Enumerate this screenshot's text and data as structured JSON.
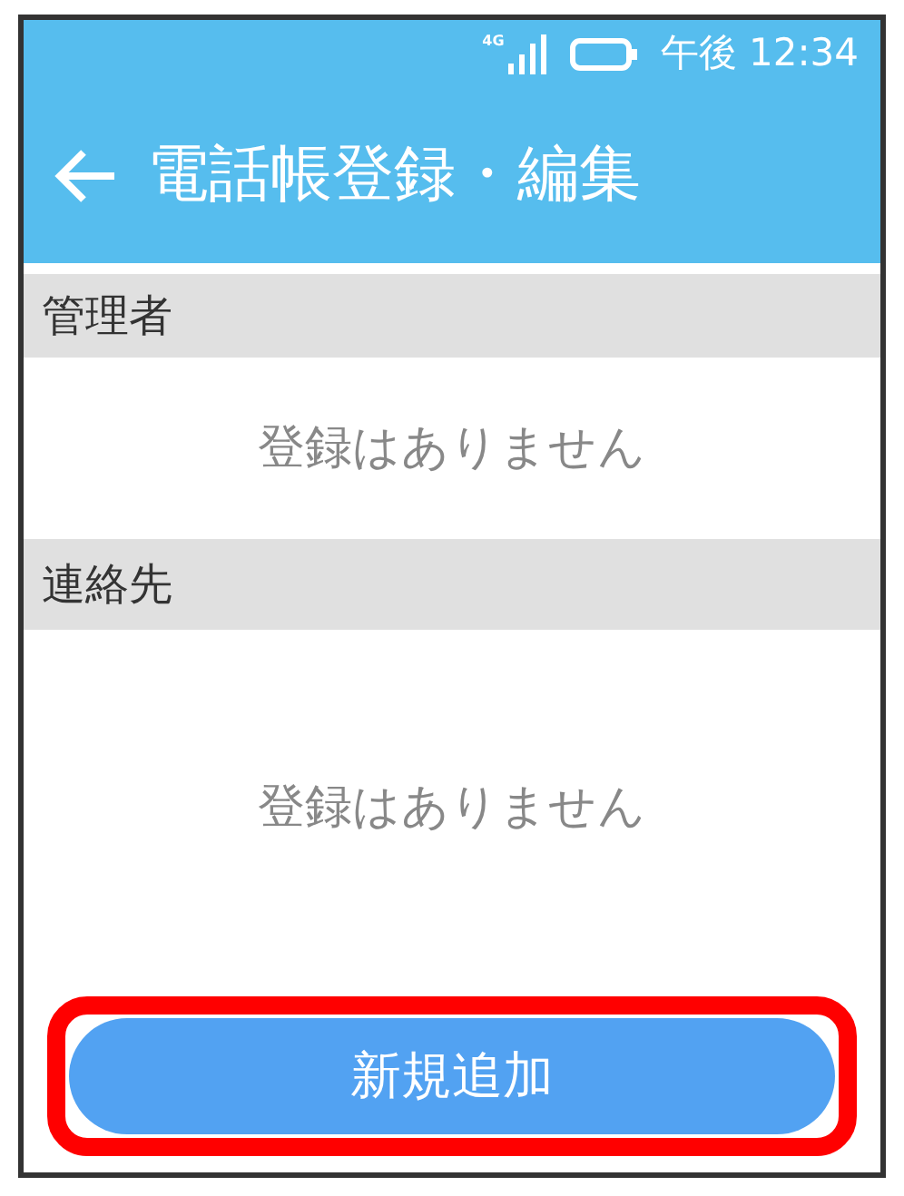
{
  "status_bar": {
    "network": "4G",
    "time": "午後 12:34"
  },
  "header": {
    "title": "電話帳登録・編集"
  },
  "sections": [
    {
      "title": "管理者",
      "empty_text": "登録はありません"
    },
    {
      "title": "連絡先",
      "empty_text": "登録はありません"
    }
  ],
  "add_button": {
    "label": "新規追加",
    "highlighted": true
  }
}
